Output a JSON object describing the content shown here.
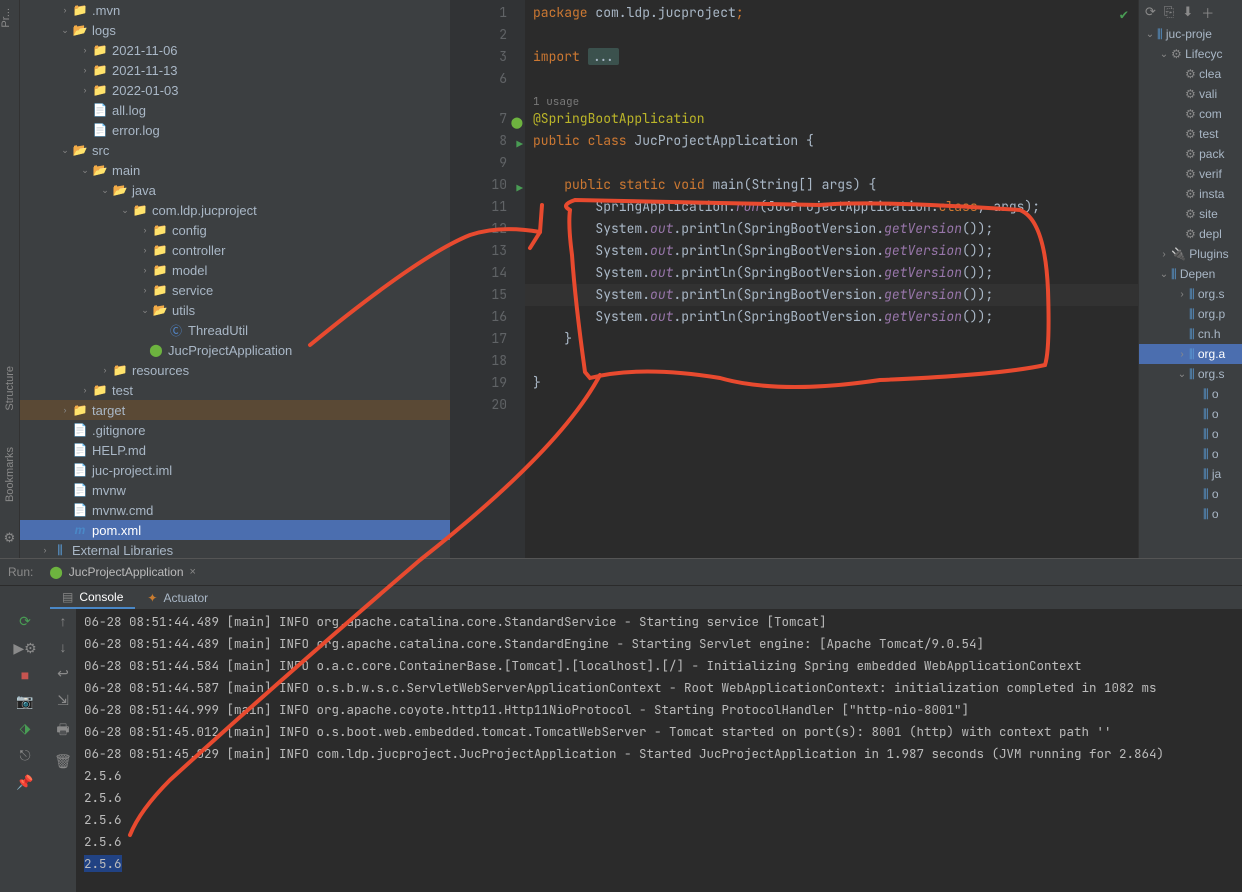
{
  "tree": {
    "mvn": ".mvn",
    "logs": "logs",
    "d1": "2021-11-06",
    "d2": "2021-11-13",
    "d3": "2022-01-03",
    "alllog": "all.log",
    "errorlog": "error.log",
    "src": "src",
    "main": "main",
    "java": "java",
    "pkg": "com.ldp.jucproject",
    "config": "config",
    "controller": "controller",
    "model": "model",
    "service": "service",
    "utils": "utils",
    "threadutil": "ThreadUtil",
    "app": "JucProjectApplication",
    "resources": "resources",
    "test": "test",
    "target": "target",
    "gitignore": ".gitignore",
    "help": "HELP.md",
    "iml": "juc-project.iml",
    "mvnw": "mvnw",
    "mvnwcmd": "mvnw.cmd",
    "pom": "pom.xml",
    "extlib": "External Libraries"
  },
  "editor": {
    "lines": [
      "1",
      "2",
      "3",
      "6",
      "",
      "7",
      "8",
      "9",
      "10",
      "11",
      "12",
      "13",
      "14",
      "15",
      "16",
      "17",
      "18",
      "19",
      "20"
    ],
    "usage": "1 usage",
    "code": {
      "l1_kw": "package",
      "l1_rest": " com.ldp.jucproject",
      "l3_kw": "import",
      "l3_fold": "...",
      "l7": "@SpringBootApplication",
      "l8_a": "public ",
      "l8_b": "class ",
      "l8_c": "JucProjectApplication {",
      "l10_a": "    public ",
      "l10_b": "static ",
      "l10_c": "void ",
      "l10_d": "main",
      "l10_e": "(String[] args) {",
      "l11_a": "        SpringApplication.",
      "l11_b": "run",
      "l11_c": "(JucProjectApplication.",
      "l11_d": "class",
      "l11_e": ", args);",
      "sysout_a": "        System.",
      "sysout_b": "out",
      "sysout_c": ".println(SpringBootVersion.",
      "sysout_d": "getVersion",
      "sysout_e": "());",
      "l17": "    }",
      "l19": "}"
    }
  },
  "rightPanel": {
    "root": "juc-proje",
    "lifecycle": "Lifecyc",
    "items": [
      "clea",
      "vali",
      "com",
      "test",
      "pack",
      "verif",
      "insta",
      "site",
      "depl"
    ],
    "plugins": "Plugins",
    "deps": "Depen",
    "orgs": "org.s",
    "orgp": "org.p",
    "cn": "cn.h",
    "orga": "org.a",
    "o": "o",
    "oa": "o",
    "ja": "ja",
    "orgs2": "org.s"
  },
  "run": {
    "label": "Run:",
    "tabApp": "JucProjectApplication",
    "console": "Console",
    "actuator": "Actuator",
    "lines": [
      "06-28 08:51:44.489 [main] INFO org.apache.catalina.core.StandardService - Starting service [Tomcat]",
      "06-28 08:51:44.489 [main] INFO org.apache.catalina.core.StandardEngine - Starting Servlet engine: [Apache Tomcat/9.0.54]",
      "06-28 08:51:44.584 [main] INFO o.a.c.core.ContainerBase.[Tomcat].[localhost].[/] - Initializing Spring embedded WebApplicationContext",
      "06-28 08:51:44.587 [main] INFO o.s.b.w.s.c.ServletWebServerApplicationContext - Root WebApplicationContext: initialization completed in 1082 ms",
      "06-28 08:51:44.999 [main] INFO org.apache.coyote.http11.Http11NioProtocol - Starting ProtocolHandler [\"http-nio-8001\"]",
      "06-28 08:51:45.012 [main] INFO o.s.boot.web.embedded.tomcat.TomcatWebServer - Tomcat started on port(s): 8001 (http) with context path ''",
      "06-28 08:51:45.029 [main] INFO com.ldp.jucproject.JucProjectApplication - Started JucProjectApplication in 1.987 seconds (JVM running for 2.864)",
      "2.5.6",
      "2.5.6",
      "2.5.6",
      "2.5.6"
    ],
    "lastLine": "2.5.6"
  }
}
